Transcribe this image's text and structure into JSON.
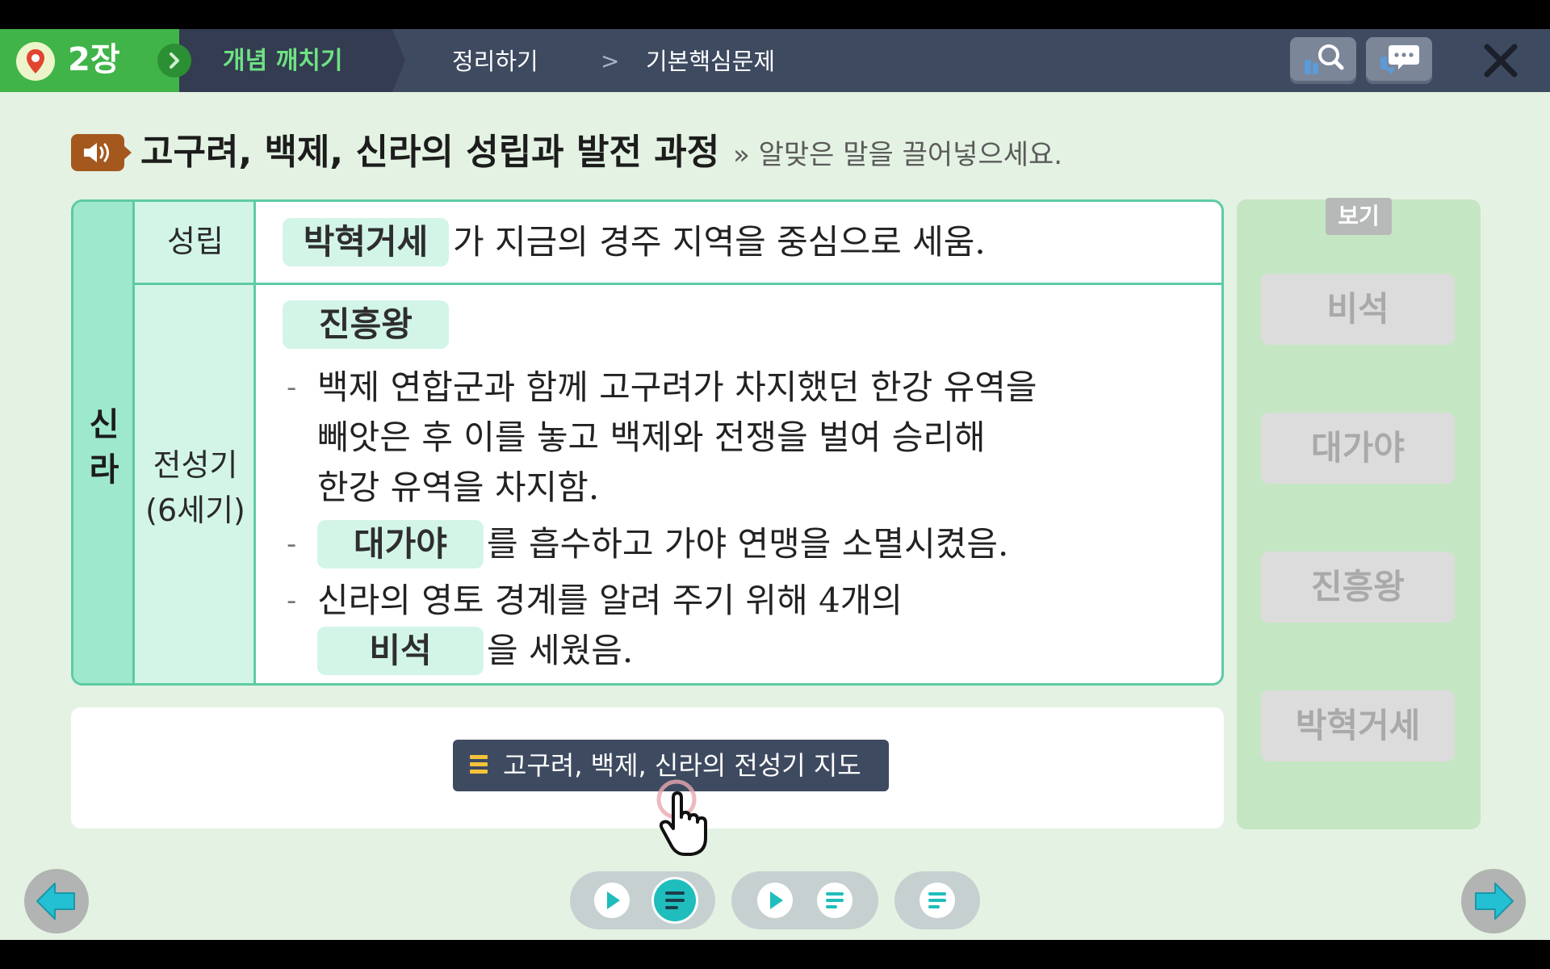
{
  "topbar": {
    "chapter": "2장",
    "steps": [
      "개념 깨치기",
      "정리하기",
      "기본핵심문제"
    ],
    "separator": ">"
  },
  "title": {
    "main": "고구려, 백제, 신라의 성립과 발전 과정",
    "instruction": "» 알맞은 말을 끌어넣으세요."
  },
  "table": {
    "country": "신\n라",
    "rows": {
      "founding": {
        "label": "성립",
        "answer": "박혁거세",
        "text": "가 지금의 경주 지역을 중심으로 세움."
      },
      "peak": {
        "label": "전성기\n(6세기)",
        "answer_top": "진흥왕",
        "bullet": "-",
        "item1": [
          "백제 연합군과 함께 고구려가 차지했던 한강 유역을",
          "빼앗은 후 이를 놓고 백제와 전쟁을 벌여 승리해",
          "한강 유역을 차지함."
        ],
        "item2_answer": "대가야",
        "item2_text": "를 흡수하고 가야 연맹을 소멸시켰음.",
        "item3_line1": "신라의 영토 경계를 알려 주기 위해 4개의",
        "item3_answer": "비석",
        "item3_text": "을 세웠음."
      }
    }
  },
  "caption": {
    "map_button": "고구려, 백제, 신라의 전성기 지도"
  },
  "word_bank": {
    "tag": "보기",
    "items": [
      "비석",
      "대가야",
      "진흥왕",
      "박혁거세"
    ]
  },
  "colors": {
    "accent_green": "#40b449",
    "table_border": "#5dcba4",
    "chip_bg": "#d3f5e8",
    "nav_dark": "#3e4a60",
    "active_teal": "#1fbdbc"
  }
}
